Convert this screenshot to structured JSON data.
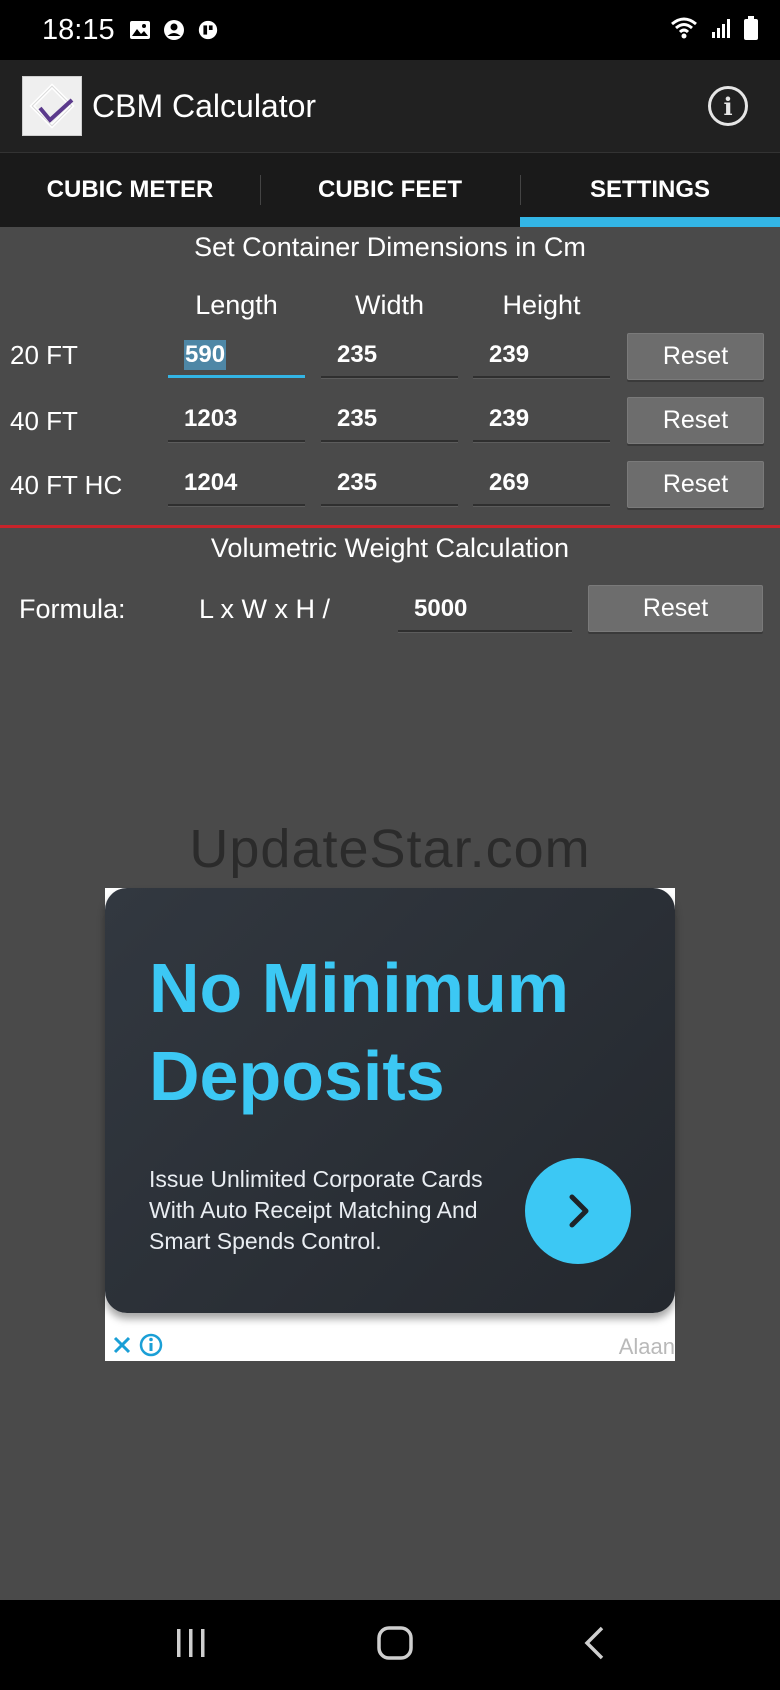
{
  "status_bar": {
    "time": "18:15",
    "left_icons": [
      "image-icon",
      "account-circle-icon",
      "app-badge-icon"
    ],
    "right_icons": [
      "wifi-icon",
      "signal-icon",
      "battery-icon"
    ]
  },
  "app_bar": {
    "title": "CBM Calculator",
    "info_icon": "info-icon"
  },
  "tabs": [
    {
      "label": "CUBIC METER",
      "active": false
    },
    {
      "label": "CUBIC FEET",
      "active": false
    },
    {
      "label": "SETTINGS",
      "active": true
    }
  ],
  "container_section": {
    "title": "Set Container Dimensions in Cm",
    "columns": [
      "Length",
      "Width",
      "Height"
    ],
    "rows": [
      {
        "label": "20 FT",
        "length": "590",
        "width": "235",
        "height": "239",
        "reset_label": "Reset"
      },
      {
        "label": "40 FT",
        "length": "1203",
        "width": "235",
        "height": "239",
        "reset_label": "Reset"
      },
      {
        "label": "40 FT HC",
        "length": "1204",
        "width": "235",
        "height": "269",
        "reset_label": "Reset"
      }
    ]
  },
  "volumetric_section": {
    "title": "Volumetric Weight Calculation",
    "formula_label": "Formula:",
    "formula_expr": "L x W x H /",
    "divisor": "5000",
    "reset_label": "Reset"
  },
  "watermark": "UpdateStar.com",
  "ad": {
    "headline_line1": "No Minimum",
    "headline_line2": "Deposits",
    "body": "Issue Unlimited Corporate Cards With Auto Receipt Matching And Smart Spends Control.",
    "brand": "Alaan",
    "accent_color": "#3cc8f4"
  },
  "colors": {
    "background": "#4a4a4a",
    "tab_indicator": "#33b5e5",
    "divider": "#c8232a"
  }
}
